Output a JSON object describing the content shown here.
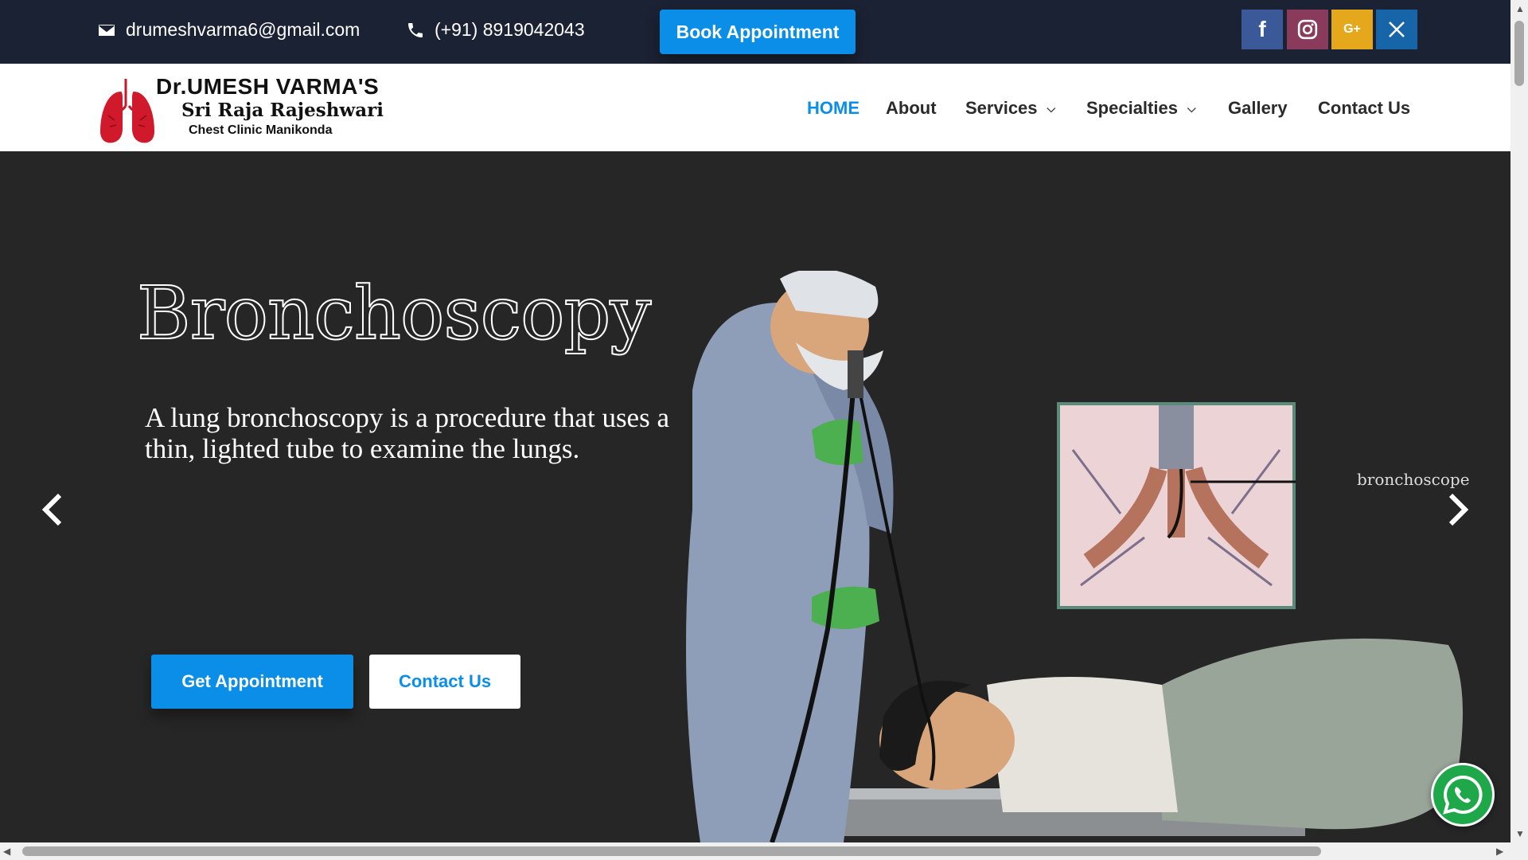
{
  "topbar": {
    "email": "drumeshvarma6@gmail.com",
    "phone": "(+91) 8919042043",
    "book_label": "Book Appointment",
    "social": {
      "facebook": "f",
      "google": "G+"
    }
  },
  "logo": {
    "line1": "Dr.UMESH VARMA'S",
    "line2": "Sri Raja Rajeshwari",
    "line3": "Chest Clinic Manikonda"
  },
  "nav": {
    "home": "HOME",
    "about": "About",
    "services": "Services",
    "specialties": "Specialties",
    "gallery": "Gallery",
    "contact": "Contact Us"
  },
  "hero": {
    "title": "Bronchoscopy",
    "description": "A lung bronchoscopy is a procedure that uses a thin, lighted tube to examine the lungs.",
    "cta_primary": "Get Appointment",
    "cta_secondary": "Contact Us",
    "inset_label": "bronchoscope"
  },
  "colors": {
    "topbar": "#1b2233",
    "accent": "#0a8ee8",
    "hero_bg": "#262626",
    "whatsapp": "#1ea84a"
  }
}
